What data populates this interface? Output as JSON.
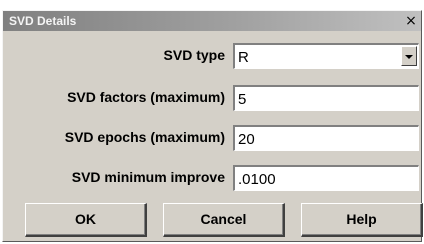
{
  "window": {
    "title": "SVD Details",
    "close_glyph": "×"
  },
  "fields": {
    "svd_type": {
      "label": "SVD type",
      "value": "R"
    },
    "svd_factors": {
      "label": "SVD factors (maximum)",
      "value": "5"
    },
    "svd_epochs": {
      "label": "SVD epochs (maximum)",
      "value": "20"
    },
    "svd_min_improve": {
      "label": "SVD minimum improve",
      "value": ".0100"
    }
  },
  "buttons": {
    "ok": "OK",
    "cancel": "Cancel",
    "help": "Help"
  },
  "icons": {
    "close": "close-icon",
    "dropdown": "chevron-down-icon"
  }
}
